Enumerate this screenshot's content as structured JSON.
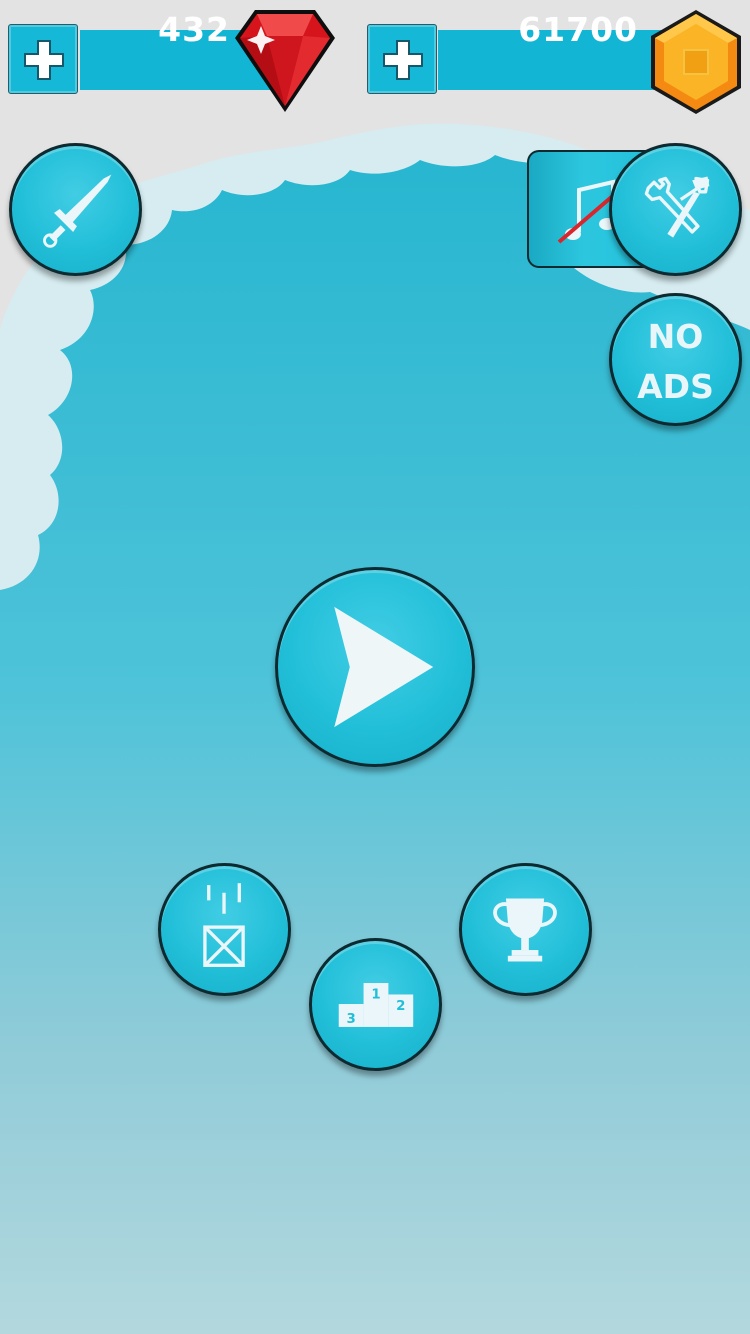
{
  "currency": {
    "gems": {
      "value": "432",
      "add_icon": "plus-icon",
      "icon": "red-gem-icon"
    },
    "coins": {
      "value": "61700",
      "add_icon": "plus-icon",
      "icon": "gold-hexagon-coin-icon"
    }
  },
  "buttons": {
    "weapon": {
      "icon": "sword-icon"
    },
    "music": {
      "icon": "music-note-muted-icon"
    },
    "settings": {
      "icon": "wrench-hammer-icon"
    },
    "no_ads": {
      "line1": "NO",
      "line2": "ADS"
    },
    "play": {
      "icon": "play-icon"
    },
    "crate": {
      "icon": "falling-crate-icon"
    },
    "leaderboard": {
      "icon": "podium-icon",
      "ranks": [
        "1",
        "2",
        "3"
      ]
    },
    "achievements": {
      "icon": "trophy-icon"
    }
  },
  "colors": {
    "sky_top": "#2cbad3",
    "sky_bottom": "#b0d6dc",
    "cloud": "#d6ecf0",
    "bar": "#12b6d4",
    "button": "#22bfd9",
    "gem": "#e0141c",
    "coin": "#f39a10"
  }
}
